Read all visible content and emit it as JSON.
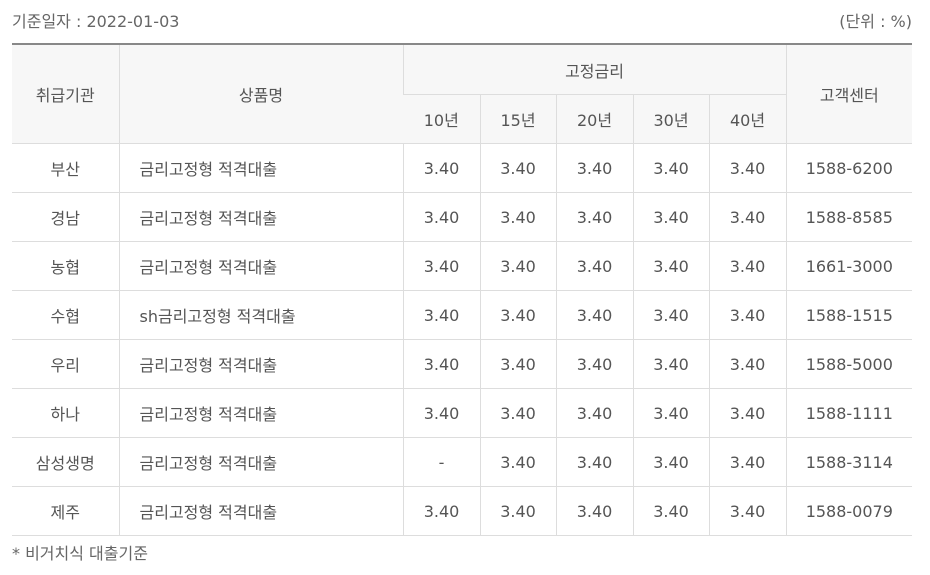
{
  "header": {
    "base_date": "기준일자 : 2022-01-03",
    "unit": "(단위 : %)"
  },
  "table": {
    "columns": {
      "institution": "취급기관",
      "product": "상품명",
      "fixed_rate": "고정금리",
      "terms": [
        "10년",
        "15년",
        "20년",
        "30년",
        "40년"
      ],
      "center": "고객센터"
    },
    "rows": [
      {
        "institution": "부산",
        "product": "금리고정형 적격대출",
        "rates": [
          "3.40",
          "3.40",
          "3.40",
          "3.40",
          "3.40"
        ],
        "center": "1588-6200"
      },
      {
        "institution": "경남",
        "product": "금리고정형 적격대출",
        "rates": [
          "3.40",
          "3.40",
          "3.40",
          "3.40",
          "3.40"
        ],
        "center": "1588-8585"
      },
      {
        "institution": "농협",
        "product": "금리고정형 적격대출",
        "rates": [
          "3.40",
          "3.40",
          "3.40",
          "3.40",
          "3.40"
        ],
        "center": "1661-3000"
      },
      {
        "institution": "수협",
        "product": "sh금리고정형 적격대출",
        "rates": [
          "3.40",
          "3.40",
          "3.40",
          "3.40",
          "3.40"
        ],
        "center": "1588-1515"
      },
      {
        "institution": "우리",
        "product": "금리고정형 적격대출",
        "rates": [
          "3.40",
          "3.40",
          "3.40",
          "3.40",
          "3.40"
        ],
        "center": "1588-5000"
      },
      {
        "institution": "하나",
        "product": "금리고정형 적격대출",
        "rates": [
          "3.40",
          "3.40",
          "3.40",
          "3.40",
          "3.40"
        ],
        "center": "1588-1111"
      },
      {
        "institution": "삼성생명",
        "product": "금리고정형 적격대출",
        "rates": [
          "-",
          "3.40",
          "3.40",
          "3.40",
          "3.40"
        ],
        "center": "1588-3114"
      },
      {
        "institution": "제주",
        "product": "금리고정형 적격대출",
        "rates": [
          "3.40",
          "3.40",
          "3.40",
          "3.40",
          "3.40"
        ],
        "center": "1588-0079"
      }
    ]
  },
  "footnote": "* 비거치식 대출기준"
}
